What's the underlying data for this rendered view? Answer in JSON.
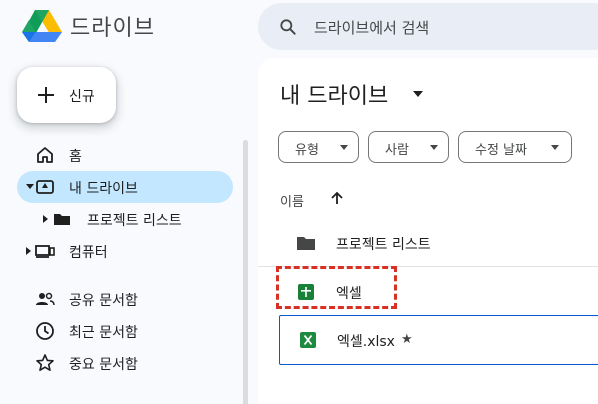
{
  "header": {
    "app_name": "드라이브",
    "search_placeholder": "드라이브에서 검색"
  },
  "new_button": {
    "label": "신규"
  },
  "sidebar": {
    "items": [
      {
        "label": "홈",
        "icon": "home-icon"
      },
      {
        "label": "내 드라이브",
        "icon": "drive-icon",
        "active": true
      },
      {
        "label": "프로젝트 리스트",
        "icon": "folder-icon"
      },
      {
        "label": "컴퓨터",
        "icon": "computer-icon"
      },
      {
        "label": "공유 문서함",
        "icon": "shared-icon"
      },
      {
        "label": "최근 문서함",
        "icon": "clock-icon"
      },
      {
        "label": "중요 문서함",
        "icon": "star-icon"
      }
    ]
  },
  "main": {
    "title": "내 드라이브",
    "filters": [
      {
        "label": "유형"
      },
      {
        "label": "사람"
      },
      {
        "label": "수정 날짜"
      }
    ],
    "column_header": "이름",
    "files": [
      {
        "name": "프로젝트 리스트",
        "type": "folder"
      },
      {
        "name": "엑셀",
        "type": "google-sheets"
      },
      {
        "name": "엑셀.xlsx",
        "type": "excel",
        "starred": true
      }
    ]
  },
  "colors": {
    "accent_active": "#c2e7ff",
    "selection_border": "#0b57d0",
    "highlight_dashed": "#d93025",
    "sheets_green": "#188038",
    "excel_green": "#1d8a3f"
  }
}
